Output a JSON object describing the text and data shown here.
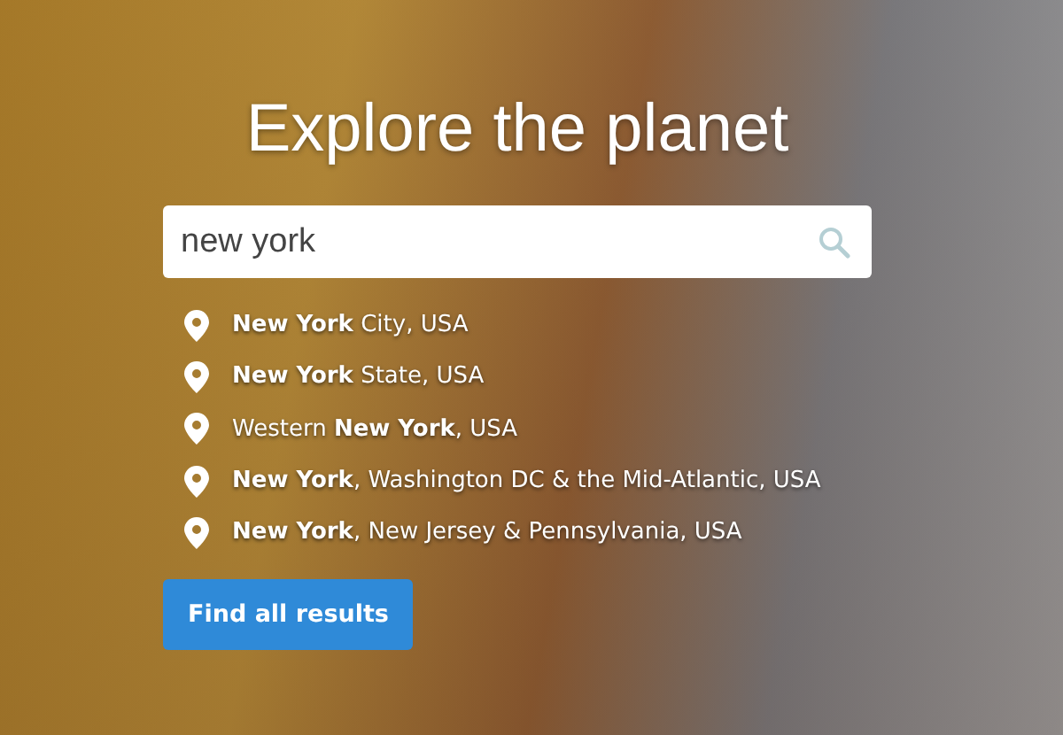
{
  "heading": "Explore the planet",
  "search": {
    "value": "new york"
  },
  "suggestions": [
    {
      "text": "**New York** City, USA"
    },
    {
      "text": "**New York** State, USA"
    },
    {
      "text": "Western **New York**, USA"
    },
    {
      "text": "**New York**, Washington DC & the Mid-Atlantic, USA"
    },
    {
      "text": "**New York**, New Jersey & Pennsylvania, USA"
    }
  ],
  "button": "Find all results"
}
